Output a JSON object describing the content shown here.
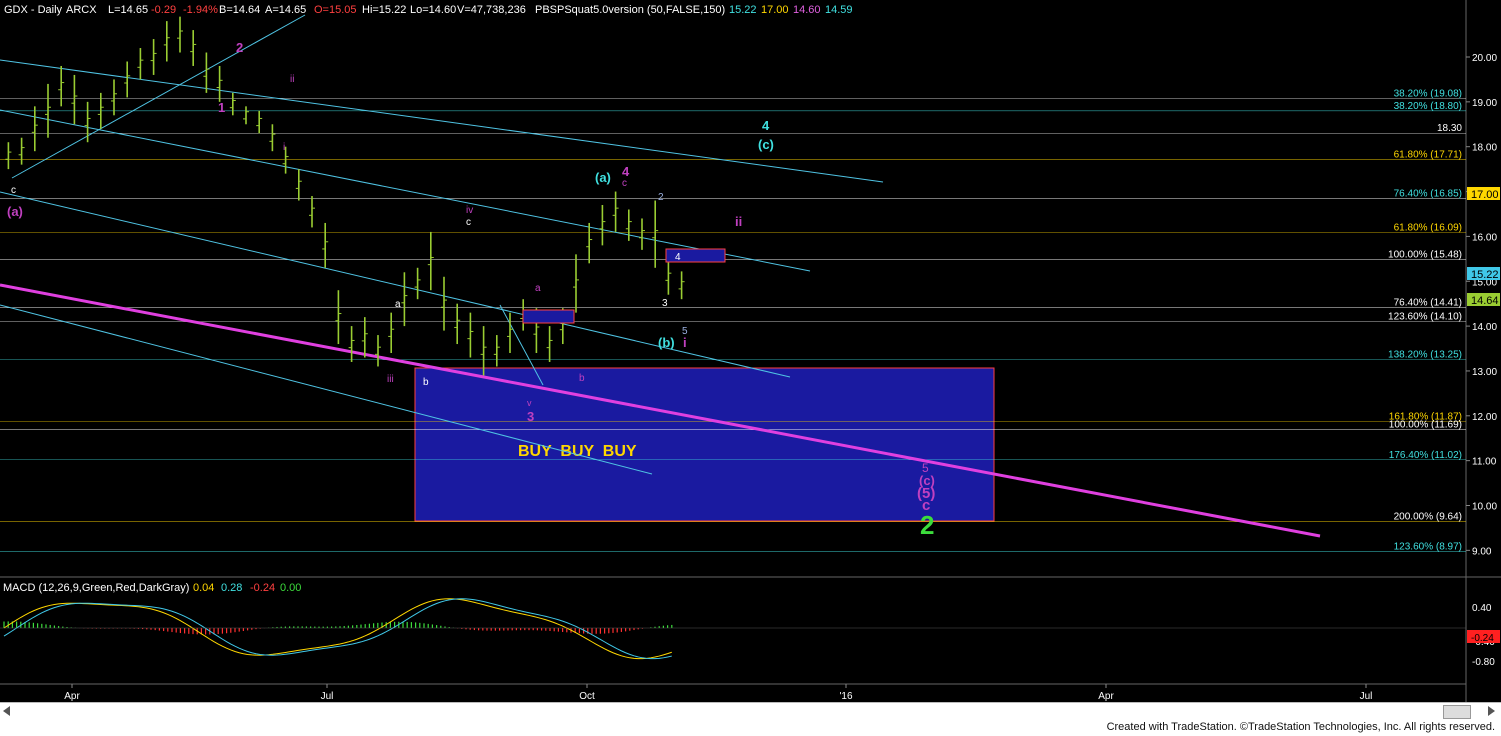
{
  "header": {
    "symbol": "GDX - Daily",
    "exchange": "ARCX",
    "last": "L=14.65",
    "change": "-0.29",
    "change_pct": "-1.94%",
    "bid": "B=14.64",
    "ask": "A=14.65",
    "open": "O=15.05",
    "high": "Hi=15.22",
    "low": "Lo=14.60",
    "volume": "V=47,738,236",
    "indicator": "PBSPSquat5.0version (50,FALSE,150)",
    "ind_vals": [
      "15.22",
      "17.00",
      "14.60",
      "14.59"
    ]
  },
  "colors": {
    "background": "#000000",
    "price_bars": "#9ACD32",
    "channel": "#4FC3E3",
    "magenta_trend": "#E040E0",
    "buy_box": "#1A1AA0",
    "cyan_label": "#40E0E0",
    "purple_label": "#C040C0",
    "green_label": "#3CDC3C"
  },
  "chart_data": {
    "type": "bar",
    "title": "GDX - Daily",
    "y_axis_labels": [
      "20.00",
      "19.00",
      "18.00",
      "17.00",
      "16.00",
      "15.00",
      "14.00",
      "13.00",
      "12.00",
      "11.00",
      "10.00",
      "9.00"
    ],
    "x_axis_labels": [
      "Apr",
      "Jul",
      "Oct",
      "'16",
      "Apr",
      "Jul"
    ],
    "ylim": [
      8.6,
      21.0
    ],
    "ohlc": [
      [
        1,
        18.1,
        17.5
      ],
      [
        4,
        18.2,
        17.6
      ],
      [
        7,
        18.9,
        17.9
      ],
      [
        10,
        19.4,
        18.2
      ],
      [
        13,
        19.8,
        18.9
      ],
      [
        16,
        19.6,
        18.5
      ],
      [
        19,
        19.0,
        18.1
      ],
      [
        22,
        19.2,
        18.4
      ],
      [
        25,
        19.5,
        18.7
      ],
      [
        28,
        19.9,
        19.1
      ],
      [
        31,
        20.2,
        19.5
      ],
      [
        34,
        20.4,
        19.6
      ],
      [
        37,
        20.8,
        19.9
      ],
      [
        40,
        20.9,
        20.1
      ],
      [
        43,
        20.6,
        19.8
      ],
      [
        46,
        20.1,
        19.2
      ],
      [
        49,
        19.8,
        19.0
      ],
      [
        52,
        19.2,
        18.7
      ],
      [
        55,
        18.9,
        18.5
      ],
      [
        58,
        18.8,
        18.3
      ],
      [
        61,
        18.5,
        17.9
      ],
      [
        64,
        18.0,
        17.4
      ],
      [
        67,
        17.5,
        16.8
      ],
      [
        70,
        16.9,
        16.2
      ],
      [
        73,
        16.3,
        15.3
      ],
      [
        76,
        14.8,
        13.6
      ],
      [
        79,
        14.0,
        13.2
      ],
      [
        82,
        14.2,
        13.3
      ],
      [
        85,
        13.8,
        13.1
      ],
      [
        88,
        14.3,
        13.4
      ],
      [
        91,
        15.2,
        14.0
      ],
      [
        94,
        15.3,
        14.6
      ],
      [
        97,
        16.1,
        14.8
      ],
      [
        100,
        15.1,
        13.9
      ],
      [
        103,
        14.5,
        13.6
      ],
      [
        106,
        14.3,
        13.3
      ],
      [
        109,
        14.0,
        12.9
      ],
      [
        112,
        13.8,
        13.1
      ],
      [
        115,
        14.3,
        13.4
      ],
      [
        118,
        14.6,
        13.9
      ],
      [
        121,
        14.4,
        13.4
      ],
      [
        124,
        14.0,
        13.2
      ],
      [
        127,
        14.4,
        13.6
      ],
      [
        130,
        15.6,
        14.3
      ],
      [
        133,
        16.3,
        15.4
      ],
      [
        136,
        16.7,
        15.8
      ],
      [
        139,
        17.0,
        16.1
      ],
      [
        142,
        16.6,
        15.9
      ],
      [
        145,
        16.4,
        15.7
      ],
      [
        148,
        16.8,
        15.3
      ],
      [
        151,
        15.5,
        14.7
      ],
      [
        154,
        15.22,
        14.6
      ]
    ],
    "horizontal_levels": [
      {
        "label": "38.20% (19.08)",
        "value": 19.08
      },
      {
        "label": "38.20% (18.80)",
        "value": 18.8
      },
      {
        "label": "18.30",
        "value": 18.3
      },
      {
        "label": "61.80% (17.71)",
        "value": 17.71
      },
      {
        "label": "76.40% (16.85)",
        "value": 16.85
      },
      {
        "label": "61.80% (16.09)",
        "value": 16.09
      },
      {
        "label": "100.00% (15.48)",
        "value": 15.48
      },
      {
        "label": "76.40% (14.41)",
        "value": 14.41
      },
      {
        "label": "123.60% (14.10)",
        "value": 14.1
      },
      {
        "label": "138.20% (13.25)",
        "value": 13.25
      },
      {
        "label": "161.80% (11.87)",
        "value": 11.87
      },
      {
        "label": "100.00% (11.69)",
        "value": 11.69
      },
      {
        "label": "176.40% (11.02)",
        "value": 11.02
      },
      {
        "label": "200.00% (9.64)",
        "value": 9.64
      },
      {
        "label": "123.60% (8.97)",
        "value": 8.97
      }
    ],
    "price_tags": [
      "17.00",
      "15.22",
      "14.64"
    ],
    "annotations": {
      "buy_text": "BUY  BUY  BUY",
      "labels": [
        "c",
        "(a)",
        "2",
        "1",
        "ii",
        "i",
        "iv",
        "c",
        "a",
        "iii",
        "b",
        "a",
        "v",
        "3",
        "b",
        "(a)",
        "4",
        "c",
        "2",
        "ii",
        "4",
        "3",
        "5",
        "(b)",
        "i",
        "4",
        "(c)",
        "5",
        "(c)",
        "(5)",
        "c",
        "2"
      ]
    },
    "macd": {
      "title": "MACD (12,26,9,Green,Red,DarkGray)",
      "values": [
        "0.04",
        "0.28",
        "-0.24",
        "0.00"
      ],
      "axis_labels": [
        "0.40",
        "-0.40",
        "-0.80"
      ],
      "tag": "-0.24"
    }
  },
  "footer": {
    "credit": "Created with TradeStation. ©TradeStation Technologies, Inc. All rights reserved."
  }
}
